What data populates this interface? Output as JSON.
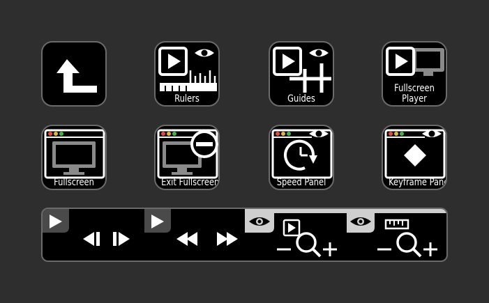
{
  "toolbar": {
    "row1": [
      {
        "id": "back",
        "icon": "return-arrow-icon",
        "label": ""
      },
      {
        "id": "rulers",
        "icon": "ruler-preview-icon",
        "label": "Rulers"
      },
      {
        "id": "guides",
        "icon": "guides-preview-icon",
        "label": "Guides"
      },
      {
        "id": "fullscreen-player",
        "icon": "monitor-preview-icon",
        "label_line1": "Fullscreen",
        "label_line2": "Player"
      }
    ],
    "row2": [
      {
        "id": "fullscreen",
        "icon": "monitor-window-icon",
        "label": "Fullscreen"
      },
      {
        "id": "exit-fullscreen",
        "icon": "exit-fullscreen-icon",
        "label": "Exit Fullscreen"
      },
      {
        "id": "speed-panel",
        "icon": "speed-clock-icon",
        "label": "Speed Panel"
      },
      {
        "id": "keyframe-panel",
        "icon": "keyframe-diamond-icon",
        "label": "Keyframe Panel"
      }
    ]
  },
  "controls": {
    "segments": [
      {
        "id": "step-frame",
        "icon": "step-frame-icon"
      },
      {
        "id": "rewind-forward",
        "icon": "rewind-fast-forward-icon"
      },
      {
        "id": "zoom-preview",
        "icon": "zoom-preview-icon"
      },
      {
        "id": "zoom-ruler",
        "icon": "zoom-ruler-icon"
      }
    ]
  },
  "colors": {
    "background": "#2e2e2e",
    "tile": "#000000",
    "border": "#6b6b6b",
    "icon": "#ffffff",
    "traffic_red": "#e64a3c",
    "traffic_yellow": "#e6b43c",
    "traffic_green": "#45b24a",
    "monitor_gray": "#8a8a8a",
    "tab_gray": "#cfcfcf"
  }
}
